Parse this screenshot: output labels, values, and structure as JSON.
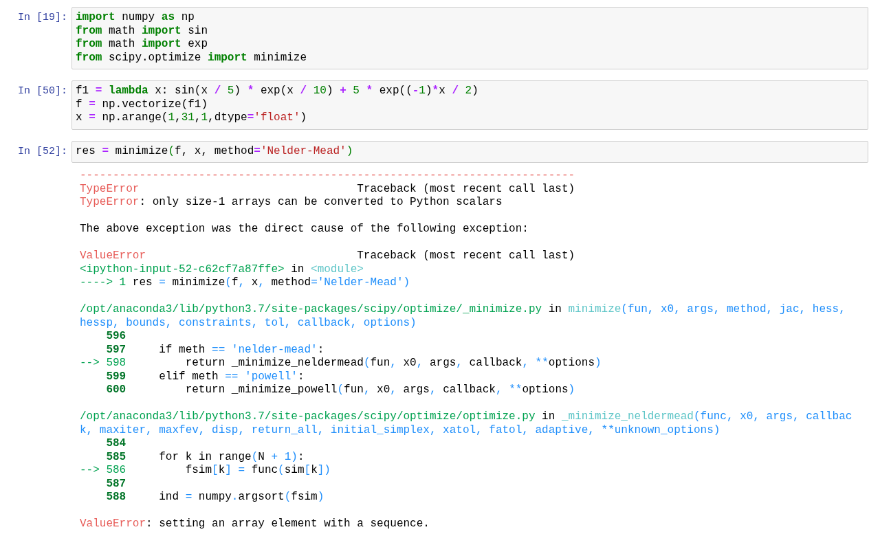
{
  "cells": [
    {
      "prompt": "In [19]:",
      "input": [
        [
          {
            "kind": "kw",
            "text": "import"
          },
          {
            "kind": "p",
            "text": " numpy "
          },
          {
            "kind": "kw",
            "text": "as"
          },
          {
            "kind": "p",
            "text": " np"
          }
        ],
        [
          {
            "kind": "kw",
            "text": "from"
          },
          {
            "kind": "p",
            "text": " math "
          },
          {
            "kind": "kw",
            "text": "import"
          },
          {
            "kind": "p",
            "text": " sin"
          }
        ],
        [
          {
            "kind": "kw",
            "text": "from"
          },
          {
            "kind": "p",
            "text": " math "
          },
          {
            "kind": "kw",
            "text": "import"
          },
          {
            "kind": "p",
            "text": " exp"
          }
        ],
        [
          {
            "kind": "kw",
            "text": "from"
          },
          {
            "kind": "p",
            "text": " scipy.optimize "
          },
          {
            "kind": "kw",
            "text": "import"
          },
          {
            "kind": "p",
            "text": " minimize"
          }
        ]
      ]
    },
    {
      "prompt": "In [50]:",
      "input": [
        [
          {
            "kind": "p",
            "text": "f1 "
          },
          {
            "kind": "op",
            "text": "="
          },
          {
            "kind": "kw",
            "text": " lambda"
          },
          {
            "kind": "p",
            "text": " x: sin(x "
          },
          {
            "kind": "op",
            "text": "/"
          },
          {
            "kind": "num",
            "text": " 5"
          },
          {
            "kind": "p",
            "text": ") "
          },
          {
            "kind": "op",
            "text": "*"
          },
          {
            "kind": "p",
            "text": " exp(x "
          },
          {
            "kind": "op",
            "text": "/"
          },
          {
            "kind": "num",
            "text": " 10"
          },
          {
            "kind": "p",
            "text": ") "
          },
          {
            "kind": "op",
            "text": "+"
          },
          {
            "kind": "num",
            "text": " 5"
          },
          {
            "kind": "op",
            "text": " *"
          },
          {
            "kind": "p",
            "text": " exp(("
          },
          {
            "kind": "op",
            "text": "-"
          },
          {
            "kind": "num",
            "text": "1"
          },
          {
            "kind": "p",
            "text": ")"
          },
          {
            "kind": "op",
            "text": "*"
          },
          {
            "kind": "p",
            "text": "x "
          },
          {
            "kind": "op",
            "text": "/"
          },
          {
            "kind": "num",
            "text": " 2"
          },
          {
            "kind": "p",
            "text": ")"
          }
        ],
        [
          {
            "kind": "p",
            "text": "f "
          },
          {
            "kind": "op",
            "text": "="
          },
          {
            "kind": "p",
            "text": " np.vectorize(f1)"
          }
        ],
        [
          {
            "kind": "p",
            "text": "x "
          },
          {
            "kind": "op",
            "text": "="
          },
          {
            "kind": "p",
            "text": " np.arange("
          },
          {
            "kind": "num",
            "text": "1"
          },
          {
            "kind": "p",
            "text": ","
          },
          {
            "kind": "num",
            "text": "31"
          },
          {
            "kind": "p",
            "text": ","
          },
          {
            "kind": "num",
            "text": "1"
          },
          {
            "kind": "p",
            "text": ",dtype"
          },
          {
            "kind": "op",
            "text": "="
          },
          {
            "kind": "str",
            "text": "'float'"
          },
          {
            "kind": "p",
            "text": ")"
          }
        ]
      ]
    },
    {
      "prompt": "In [52]:",
      "input": [
        [
          {
            "kind": "p",
            "text": "res "
          },
          {
            "kind": "op",
            "text": "="
          },
          {
            "kind": "p",
            "text": " minimize"
          },
          {
            "kind": "num",
            "text": "("
          },
          {
            "kind": "p",
            "text": "f, x, method"
          },
          {
            "kind": "op",
            "text": "="
          },
          {
            "kind": "str",
            "text": "'Nelder-Mead'"
          },
          {
            "kind": "num",
            "text": ")"
          }
        ]
      ],
      "output": [
        [
          [
            {
              "kind": "err",
              "text": "---------------------------------------------------------------------------"
            }
          ],
          [
            {
              "kind": "err",
              "text": "TypeError"
            },
            {
              "kind": "p",
              "text": "                                 Traceback (most recent call last)"
            }
          ],
          [
            {
              "kind": "err",
              "text": "TypeError"
            },
            {
              "kind": "p",
              "text": ": only size-1 arrays can be converted to Python scalars"
            }
          ]
        ],
        [
          [
            {
              "kind": "p",
              "text": "The above exception was the direct cause of the following exception:"
            }
          ]
        ],
        [
          [
            {
              "kind": "err",
              "text": "ValueError"
            },
            {
              "kind": "p",
              "text": "                                Traceback (most recent call last)"
            }
          ],
          [
            {
              "kind": "path",
              "text": "<ipython-input-52-c62cf7a87ffe>"
            },
            {
              "kind": "p",
              "text": " in "
            },
            {
              "kind": "cyan",
              "text": "<module>"
            }
          ],
          [
            {
              "kind": "path",
              "text": "----> 1"
            },
            {
              "kind": "p",
              "text": " res "
            },
            {
              "kind": "blue",
              "text": "="
            },
            {
              "kind": "p",
              "text": " minimize"
            },
            {
              "kind": "blue",
              "text": "("
            },
            {
              "kind": "p",
              "text": "f"
            },
            {
              "kind": "blue",
              "text": ","
            },
            {
              "kind": "p",
              "text": " x"
            },
            {
              "kind": "blue",
              "text": ","
            },
            {
              "kind": "p",
              "text": " method"
            },
            {
              "kind": "blue",
              "text": "='Nelder-Mead')"
            }
          ]
        ],
        [
          [
            {
              "kind": "path",
              "text": "/opt/anaconda3/lib/python3.7/site-packages/scipy/optimize/_minimize.py"
            },
            {
              "kind": "p",
              "text": " in "
            },
            {
              "kind": "cyan",
              "text": "minimize"
            },
            {
              "kind": "blue",
              "text": "(fun, x0, args, method, jac, hess,"
            }
          ],
          [
            {
              "kind": "blue",
              "text": "hessp, bounds, constraints, tol, callback, options)"
            }
          ],
          [
            {
              "kind": "ln",
              "text": "    596"
            }
          ],
          [
            {
              "kind": "ln",
              "text": "    597"
            },
            {
              "kind": "p",
              "text": "     if meth "
            },
            {
              "kind": "blue",
              "text": "== 'nelder-mead'"
            },
            {
              "kind": "p",
              "text": ":"
            }
          ],
          [
            {
              "kind": "arrow",
              "text": "--> 598"
            },
            {
              "kind": "p",
              "text": "         return _minimize_neldermead"
            },
            {
              "kind": "blue",
              "text": "("
            },
            {
              "kind": "p",
              "text": "fun"
            },
            {
              "kind": "blue",
              "text": ","
            },
            {
              "kind": "p",
              "text": " x0"
            },
            {
              "kind": "blue",
              "text": ","
            },
            {
              "kind": "p",
              "text": " args"
            },
            {
              "kind": "blue",
              "text": ","
            },
            {
              "kind": "p",
              "text": " callback"
            },
            {
              "kind": "blue",
              "text": ", **"
            },
            {
              "kind": "p",
              "text": "options"
            },
            {
              "kind": "blue",
              "text": ")"
            }
          ],
          [
            {
              "kind": "ln",
              "text": "    599"
            },
            {
              "kind": "p",
              "text": "     elif meth "
            },
            {
              "kind": "blue",
              "text": "== 'powell'"
            },
            {
              "kind": "p",
              "text": ":"
            }
          ],
          [
            {
              "kind": "ln",
              "text": "    600"
            },
            {
              "kind": "p",
              "text": "         return _minimize_powell"
            },
            {
              "kind": "blue",
              "text": "("
            },
            {
              "kind": "p",
              "text": "fun"
            },
            {
              "kind": "blue",
              "text": ","
            },
            {
              "kind": "p",
              "text": " x0"
            },
            {
              "kind": "blue",
              "text": ","
            },
            {
              "kind": "p",
              "text": " args"
            },
            {
              "kind": "blue",
              "text": ","
            },
            {
              "kind": "p",
              "text": " callback"
            },
            {
              "kind": "blue",
              "text": ", **"
            },
            {
              "kind": "p",
              "text": "options"
            },
            {
              "kind": "blue",
              "text": ")"
            }
          ]
        ],
        [
          [
            {
              "kind": "path",
              "text": "/opt/anaconda3/lib/python3.7/site-packages/scipy/optimize/optimize.py"
            },
            {
              "kind": "p",
              "text": " in "
            },
            {
              "kind": "cyan",
              "text": "_minimize_neldermead"
            },
            {
              "kind": "blue",
              "text": "(func, x0, args, callbac"
            }
          ],
          [
            {
              "kind": "blue",
              "text": "k, maxiter, maxfev, disp, return_all, initial_simplex, xatol, fatol, adaptive, **unknown_options)"
            }
          ],
          [
            {
              "kind": "ln",
              "text": "    584"
            }
          ],
          [
            {
              "kind": "ln",
              "text": "    585"
            },
            {
              "kind": "p",
              "text": "     for k in range"
            },
            {
              "kind": "blue",
              "text": "("
            },
            {
              "kind": "p",
              "text": "N "
            },
            {
              "kind": "blue",
              "text": "+ 1)"
            },
            {
              "kind": "p",
              "text": ":"
            }
          ],
          [
            {
              "kind": "arrow",
              "text": "--> 586"
            },
            {
              "kind": "p",
              "text": "         fsim"
            },
            {
              "kind": "blue",
              "text": "["
            },
            {
              "kind": "p",
              "text": "k"
            },
            {
              "kind": "blue",
              "text": "] ="
            },
            {
              "kind": "p",
              "text": " func"
            },
            {
              "kind": "blue",
              "text": "("
            },
            {
              "kind": "p",
              "text": "sim"
            },
            {
              "kind": "blue",
              "text": "["
            },
            {
              "kind": "p",
              "text": "k"
            },
            {
              "kind": "blue",
              "text": "])"
            }
          ],
          [
            {
              "kind": "ln",
              "text": "    587"
            }
          ],
          [
            {
              "kind": "ln",
              "text": "    588"
            },
            {
              "kind": "p",
              "text": "     ind "
            },
            {
              "kind": "blue",
              "text": "="
            },
            {
              "kind": "p",
              "text": " numpy"
            },
            {
              "kind": "blue",
              "text": "."
            },
            {
              "kind": "p",
              "text": "argsort"
            },
            {
              "kind": "blue",
              "text": "("
            },
            {
              "kind": "p",
              "text": "fsim"
            },
            {
              "kind": "blue",
              "text": ")"
            }
          ]
        ],
        [
          [
            {
              "kind": "err",
              "text": "ValueError"
            },
            {
              "kind": "p",
              "text": ": setting an array element with a sequence."
            }
          ]
        ]
      ]
    }
  ]
}
